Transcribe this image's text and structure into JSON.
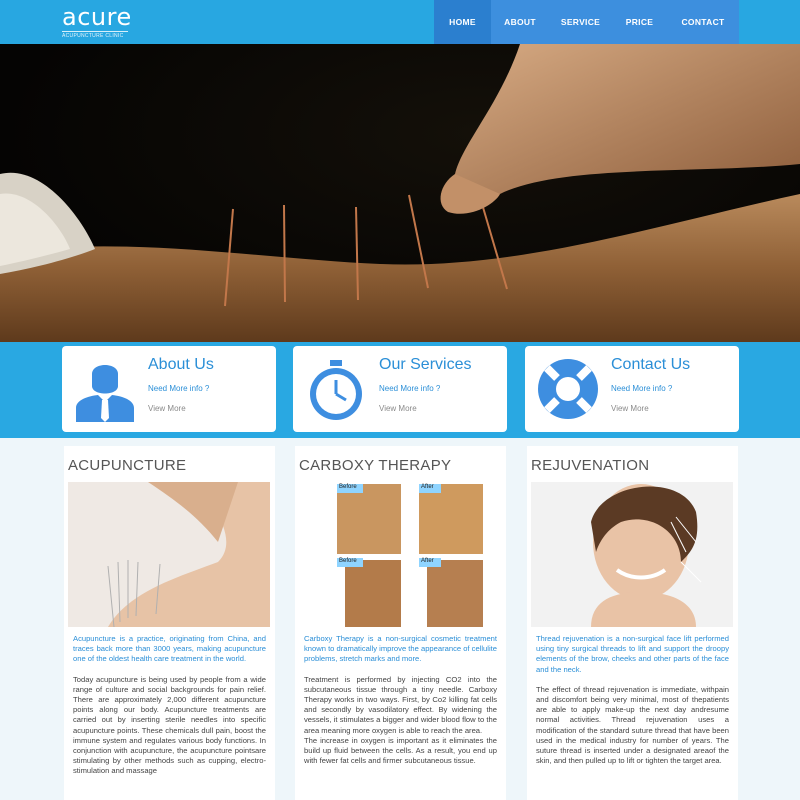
{
  "brand": {
    "logo_text": "acure",
    "logo_subtext": "ACUPUNCTURE CLINIC"
  },
  "nav": {
    "items": [
      {
        "label": "HOME",
        "active": true
      },
      {
        "label": "ABOUT"
      },
      {
        "label": "SERVICE"
      },
      {
        "label": "PRICE"
      },
      {
        "label": "CONTACT"
      }
    ]
  },
  "info_cards": [
    {
      "title": "About Us",
      "link": "Need More info ?",
      "more": "View More",
      "icon": "person-icon"
    },
    {
      "title": "Our Services",
      "link": "Need More info ?",
      "more": "View More",
      "icon": "stopwatch-icon"
    },
    {
      "title": "Contact Us",
      "link": "Need More info ?",
      "more": "View More",
      "icon": "lifebuoy-icon"
    }
  ],
  "columns": [
    {
      "title": "ACUPUNCTURE",
      "lead": "Acupuncture is a practice, originating from China, and traces back more than 3000 years, making acupuncture one of the oldest health care treatment in the world.",
      "paragraphs": [
        "Today acupuncture is being used by people from a wide range of culture and social backgrounds for pain relief. There are approximately 2,000 different acupuncture points along our body. Acupuncture treatments are carried out by inserting sterile needles into specific acupuncture points. These chemicals dull pain, boost the immune system and regulates various body functions. In conjunction with acupuncture, the acupuncture pointsare stimulating by other methods such as cupping, electro-stimulation and massage"
      ]
    },
    {
      "title": "CARBOXY THERAPY",
      "image_labels": [
        "Before",
        "After",
        "Before",
        "After"
      ],
      "lead": "Carboxy Therapy is a non-surgical cosmetic treatment known to dramatically improve the appearance of cellulite problems, stretch marks and more.",
      "paragraphs": [
        "Treatment is performed by injecting CO2 into the subcutaneous tissue through a tiny needle. Carboxy Therapy works in two ways. First, by Co2 killing fat cells and secondly by vasodilatory effect. By widening the vessels, it stimulates a bigger and wider blood flow to the area meaning more oxygen is able to reach the area.",
        "The increase in oxygen is important as it eliminates the build up fluid between the cells. As a result, you end up with fewer fat cells and firmer subcutaneous tissue."
      ]
    },
    {
      "title": "REJUVENATION",
      "lead": "Thread rejuvenation is a non-surgical face lift performed using tiny surgical threads to lift and support the droopy elements of the brow, cheeks and other parts of the face and the neck.",
      "paragraphs": [
        "The effect of thread rejuvenation is immediate, withpain and discomfort being very minimal, most of thepatients are able to apply make-up the next day andresume normal activities. Thread rejuvenation uses a modification of the standard suture thread that have been used in the medical industry for number of years. The suture thread is inserted under a designated areaof the skin, and then pulled up to lift or tighten the target area."
      ]
    }
  ],
  "colors": {
    "header_bg": "#28a7e1",
    "nav_bg": "#3d8fde",
    "nav_active_bg": "#2b7fcf",
    "accent_text": "#2b8fd7",
    "icon_blue": "#3e8ee0"
  }
}
